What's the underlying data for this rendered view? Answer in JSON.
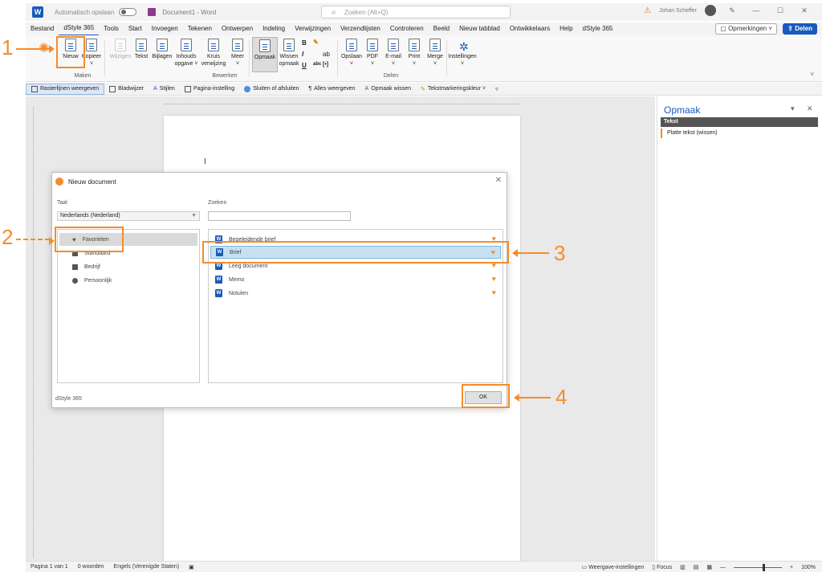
{
  "titlebar": {
    "autosave_label": "Automatisch opslaan",
    "doc_title": "Document1 - Word",
    "search_placeholder": "Zoeken (Alt+Q)",
    "user_name": "Johan Scheffer"
  },
  "menu": {
    "tabs": [
      "Bestand",
      "dStyle 365",
      "Tools",
      "Start",
      "Invoegen",
      "Tekenen",
      "Ontwerpen",
      "Indeling",
      "Verwijzingen",
      "Verzendlijsten",
      "Controleren",
      "Beeld",
      "Nieuw tabblad",
      "Ontwikkelaars",
      "Help",
      "dStyle 365"
    ],
    "comments_label": "Opmerkingen",
    "share_label": "Delen"
  },
  "ribbon": {
    "buttons": [
      {
        "label": "Nieuw",
        "sub": ""
      },
      {
        "label": "Kopieer",
        "sub": "˅"
      },
      {
        "label": "Wijzigen",
        "sub": ""
      },
      {
        "label": "Tekst",
        "sub": ""
      },
      {
        "label": "Bijlagen",
        "sub": ""
      },
      {
        "label": "Inhouds",
        "sub": "opgave ˅"
      },
      {
        "label": "Kruis",
        "sub": "verwijzing"
      },
      {
        "label": "Meer",
        "sub": "˅"
      },
      {
        "label": "Opmaak",
        "sub": ""
      },
      {
        "label": "Wissen",
        "sub": "opmaak"
      },
      {
        "label": "Opslaan",
        "sub": "˅"
      },
      {
        "label": "PDF",
        "sub": "˅"
      },
      {
        "label": "E-mail",
        "sub": "˅"
      },
      {
        "label": "Print",
        "sub": "˅"
      },
      {
        "label": "Merge",
        "sub": "˅"
      },
      {
        "label": "Instellingen",
        "sub": "˅"
      }
    ],
    "groups": {
      "maken": "Maken",
      "bewerken": "Bewerken",
      "delen": "Delen"
    },
    "format_glyphs": {
      "bold": "B",
      "italic": "I",
      "underline": "U",
      "smallcaps": "abc",
      "paint": "ab",
      "field": "[•]"
    }
  },
  "toolbar2": {
    "items": [
      "Rasterlijnen weergeven",
      "Bladwijzer",
      "Stijlen",
      "Pagina-instelling",
      "Sluiten of afsluiten",
      "Alles weergeven",
      "Opmaak wissen",
      "Tekstmarkeringskleur ˅"
    ]
  },
  "sidepane": {
    "title": "Opmaak",
    "header": "Tekst",
    "item": "Platte tekst (wissen)"
  },
  "dialog": {
    "title": "Nieuw document",
    "language_label": "Taal",
    "language_value": "Nederlands (Nederland)",
    "search_label": "Zoeken",
    "categories": [
      "Favorieten",
      "Standaard",
      "Bedrijf",
      "Persoonlijk"
    ],
    "documents": [
      "Begeleidende brief",
      "Brief",
      "Leeg document",
      "Memo",
      "Notulen"
    ],
    "footer": "dStyle 365",
    "ok_label": "OK"
  },
  "statusbar": {
    "page": "Pagina 1 van 1",
    "words": "0 woorden",
    "language": "Engels (Verenigde Staten)",
    "display_settings": "Weergave-instellingen",
    "focus": "Focus",
    "zoom": "100%"
  },
  "annotations": [
    "1",
    "2",
    "3",
    "4"
  ],
  "colors": {
    "accent": "#185abd",
    "annotation": "#f48c2c",
    "selection": "#c8e1f2"
  }
}
